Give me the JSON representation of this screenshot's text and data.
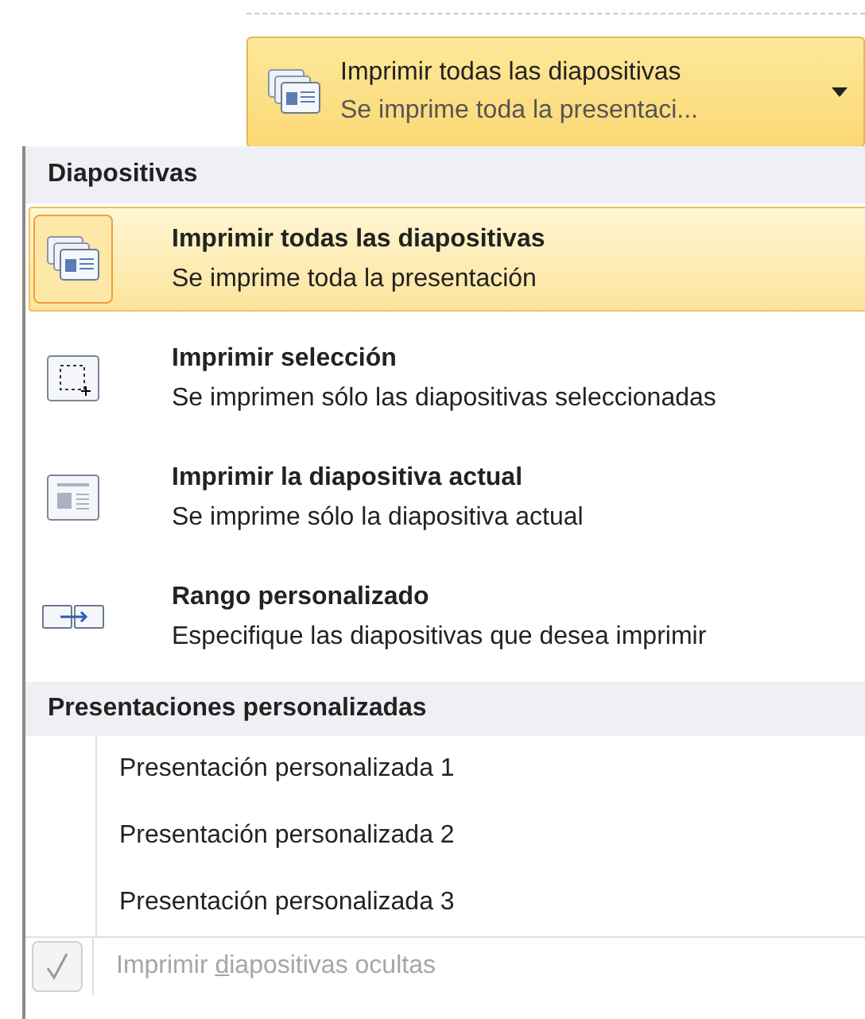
{
  "dropdown_button": {
    "title": "Imprimir todas las diapositivas",
    "subtitle": "Se imprime toda la presentaci..."
  },
  "menu": {
    "sections": [
      {
        "header": "Diapositivas",
        "kind": "icon-list",
        "items": [
          {
            "title": "Imprimir todas las diapositivas",
            "subtitle": "Se imprime toda la presentación",
            "selected": true
          },
          {
            "title": "Imprimir selección",
            "subtitle": "Se imprimen sólo las diapositivas seleccionadas",
            "selected": false
          },
          {
            "title": "Imprimir la diapositiva actual",
            "subtitle": "Se imprime sólo la diapositiva actual",
            "selected": false
          },
          {
            "title": "Rango personalizado",
            "subtitle": "Especifique las diapositivas que desea imprimir",
            "selected": false
          }
        ]
      },
      {
        "header": "Presentaciones personalizadas",
        "kind": "text-list",
        "items": [
          {
            "label": "Presentación personalizada 1",
            "selected": false
          },
          {
            "label": "Presentación personalizada 2",
            "selected": false
          },
          {
            "label": "Presentación personalizada 3",
            "selected": false
          }
        ]
      }
    ],
    "option": {
      "label_before": "Imprimir ",
      "access_key": "d",
      "label_after": "iapositivas ocultas",
      "checked": true,
      "disabled": true
    }
  }
}
